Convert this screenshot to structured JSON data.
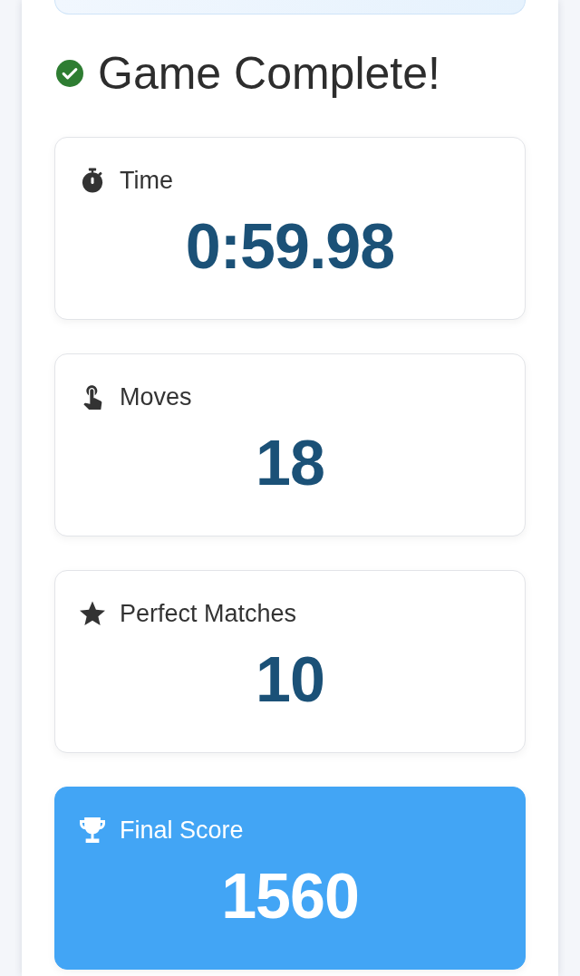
{
  "heading": {
    "title": "Game Complete!"
  },
  "stats": [
    {
      "kind": "stat",
      "label": "Time",
      "value": "0:59.98"
    },
    {
      "kind": "stat",
      "label": "Moves",
      "value": "18"
    },
    {
      "kind": "stat",
      "label": "Perfect Matches",
      "value": "10"
    },
    {
      "kind": "score",
      "label": "Final Score",
      "value": "1560"
    }
  ]
}
